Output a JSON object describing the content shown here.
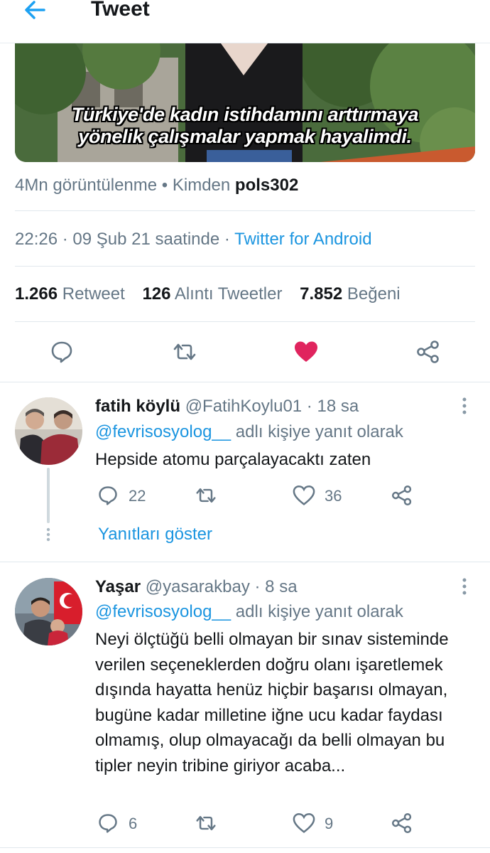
{
  "header": {
    "title": "Tweet",
    "back_icon": "arrow-left-icon"
  },
  "video": {
    "caption_line1": "Türkiye'de kadın istihdamını arttırmaya",
    "caption_line2": "yönelik çalışmalar yapmak hayalimdi."
  },
  "meta": {
    "views": "4Mn görüntülenme",
    "sep": "•",
    "from": "Kimden",
    "user": "pols302",
    "time": "22:26 · 09 Şub 21 saatinde ·",
    "client": "Twitter for Android"
  },
  "stats": {
    "retweets_count": "1.266",
    "retweets_label": "Retweet",
    "quotes_count": "126",
    "quotes_label": "Alıntı Tweetler",
    "likes_count": "7.852",
    "likes_label": "Beğeni"
  },
  "colors": {
    "accent": "#1da1f2",
    "like": "#e0245e",
    "secondary": "#657786"
  },
  "replies": [
    {
      "name": "fatih köylü",
      "handle": "@FatihKoylu01 · 18 sa",
      "reply_to": "@fevrisosyolog__",
      "reply_to_suffix": "adlı kişiye yanıt olarak",
      "text": "Hepside atomu parçalayacaktı zaten",
      "reply_count": "22",
      "like_count": "36",
      "show_replies": "Yanıtları göster"
    },
    {
      "name": "Yaşar",
      "handle": "@yasarakbay · 8 sa",
      "reply_to": "@fevrisosyolog__",
      "reply_to_suffix": "adlı kişiye yanıt olarak",
      "text": "Neyi ölçtüğü belli olmayan bir sınav sisteminde verilen seçeneklerden doğru olanı işaretlemek dışında hayatta henüz hiçbir başarısı olmayan, bugüne kadar milletine iğne ucu kadar faydası olmamış, olup olmayacağı da belli olmayan bu tipler neyin tribine giriyor acaba...",
      "reply_count": "6",
      "like_count": "9"
    }
  ]
}
